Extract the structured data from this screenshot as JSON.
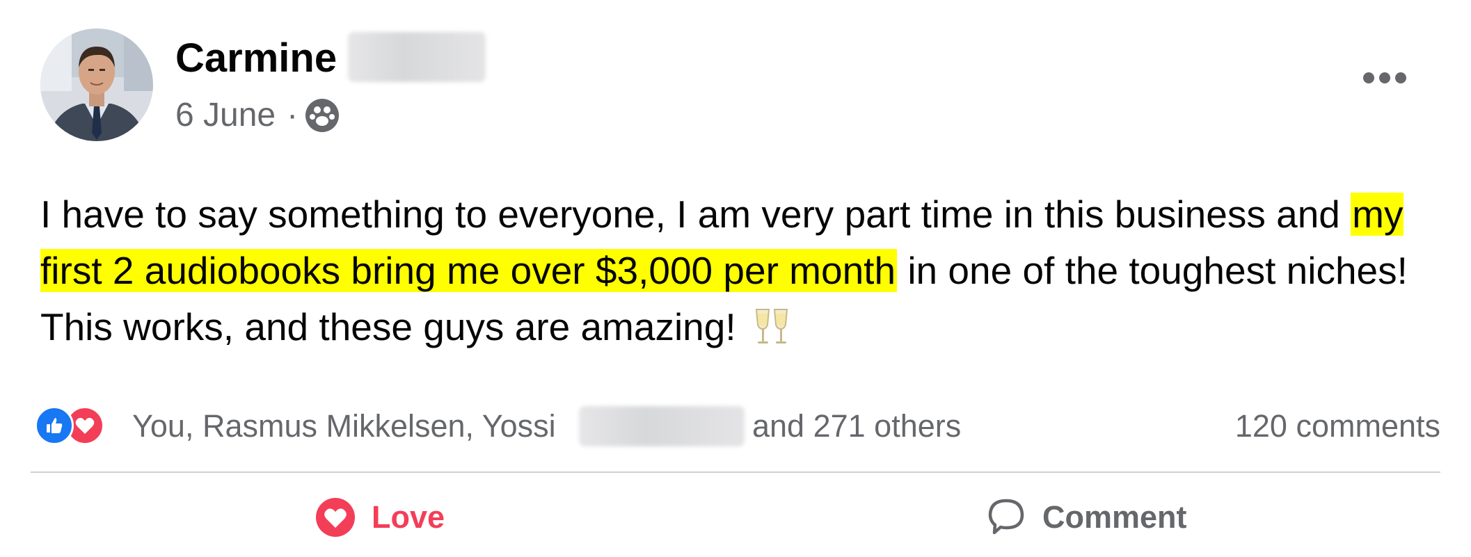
{
  "post": {
    "author": {
      "first_name": "Carmine",
      "last_name_blurred": true
    },
    "date": "6 June",
    "separator": "·",
    "audience_icon": "group-audience-icon",
    "more_icon": "more-options-icon",
    "text": {
      "before": "I have to say something to everyone, I am very part time in this business and ",
      "highlight": "my first 2 audiobooks bring me over $3,000 per month",
      "after": " in one of the toughest niches! This works, and these guys are amazing! ",
      "emoji": "clinking-glasses-icon"
    },
    "highlight_color": "#ffff00"
  },
  "reactions": {
    "icons": [
      "like-icon",
      "love-icon"
    ],
    "people_text": "You, Rasmus Mikkelsen, Yossi",
    "others_text": "and 271 others",
    "comments_text": "120 comments"
  },
  "actions": {
    "love_label": "Love",
    "comment_label": "Comment"
  },
  "colors": {
    "love": "#f33e58",
    "like": "#1877f2",
    "secondary_text": "#65676b",
    "primary_text": "#050505"
  }
}
